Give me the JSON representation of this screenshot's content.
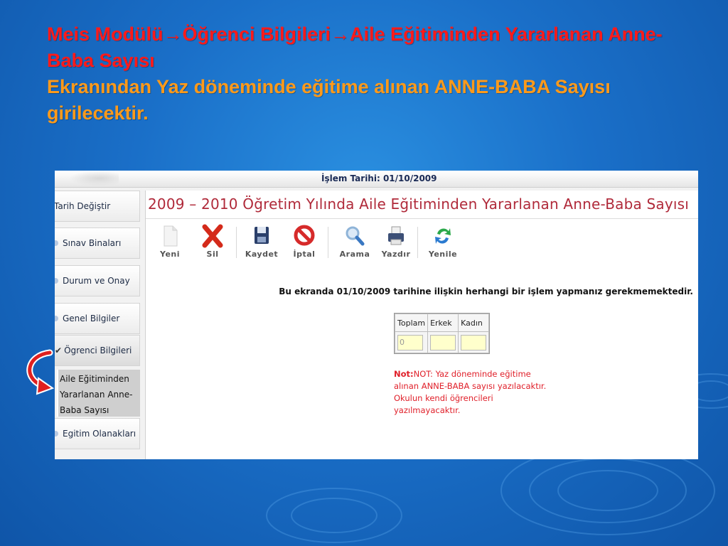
{
  "slide": {
    "title_line_red": "Meis Modülü→Öğrenci Bilgileri→Aile Eğitiminden Yararlanan Anne-Baba Sayısı",
    "title_line_orange": "Ekranından Yaz döneminde eğitime alınan ANNE-BABA Sayısı girilecektir."
  },
  "app": {
    "process_date": "İşlem Tarihi: 01/10/2009",
    "page_title": "2009 – 2010 Öğretim Yılında Aile Eğitiminden Yararlanan Anne-Baba Sayısı"
  },
  "sidebar": {
    "items": [
      {
        "label": "Tarih Değiştir"
      },
      {
        "label": "Sınav Binaları"
      },
      {
        "label": "Durum ve Onay"
      },
      {
        "label": "Genel Bilgiler"
      },
      {
        "label": "Ögrenci Bilgileri"
      },
      {
        "label": "Egitim Olanakları"
      }
    ],
    "submenu_label": "Aile Eğitiminden Yararlanan Anne-Baba Sayısı"
  },
  "toolbar": {
    "new_label": "Yeni",
    "delete_label": "Sil",
    "save_label": "Kaydet",
    "cancel_label": "İptal",
    "search_label": "Arama",
    "print_label": "Yazdır",
    "refresh_label": "Yenile"
  },
  "main": {
    "info_text": "Bu ekranda 01/10/2009 tarihine ilişkin herhangi bir işlem yapmanız gerekmemektedir.",
    "table": {
      "headers": [
        "Toplam",
        "Erkek",
        "Kadın"
      ],
      "values": [
        "0",
        "",
        ""
      ]
    },
    "note_label": "Not:",
    "note_text": "NOT: Yaz döneminde eğitime alınan ANNE-BABA sayısı yazılacaktır. Okulun kendi öğrencileri yazılmayacaktır."
  },
  "colors": {
    "title_red": "#ff1a1a",
    "title_orange": "#ff9a1a",
    "page_title": "#b02a3a",
    "note": "#e0202a",
    "input_bg": "#ffffcc"
  }
}
